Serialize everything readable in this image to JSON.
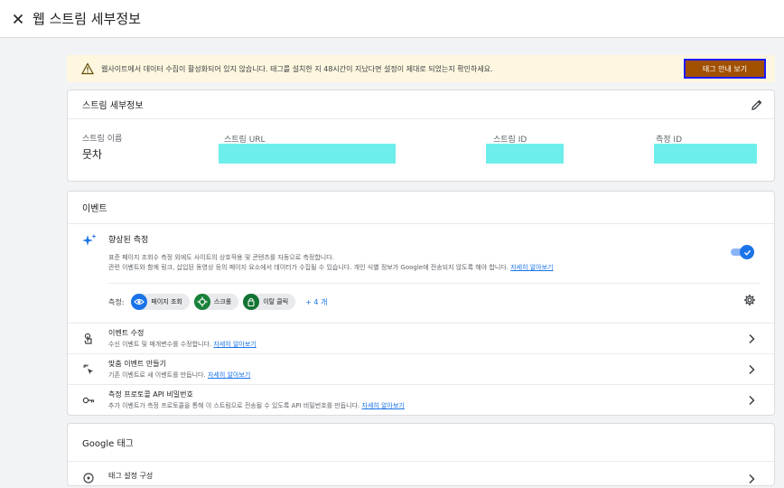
{
  "header": {
    "title": "웹 스트림 세부정보",
    "close_icon": "close-icon"
  },
  "warning": {
    "icon": "warning-icon",
    "text": "웹사이트에서 데이터 수집이 활성화되어 있지 않습니다. 태그를 설치한 지 48시간이 지났다면 설정이 제대로 되었는지 확인하세요.",
    "button_label": "태그 안내 보기",
    "button_color": "#a14f00"
  },
  "stream_details": {
    "title": "스트림 세부정보",
    "edit_icon": "pencil-icon",
    "fields": {
      "name_label": "스트림 이름",
      "name_value": "뭇차",
      "url_label": "스트림 URL",
      "id_label": "스트림 ID",
      "measurement_label": "측정 ID"
    },
    "redaction_color": "#6eeeea"
  },
  "events": {
    "title": "이벤트",
    "enhanced": {
      "icon": "sparkle-icon",
      "title": "향상된 측정",
      "desc_line1": "표준 페이지 조회수 측정 외에도 사이트의 상호작용 및 콘텐츠를 자동으로 측정합니다.",
      "desc_line2": "관련 이벤트와 함께 링크, 삽입된 동영상 등의 페이지 요소에서 데이터가 수집될 수 있습니다. 개인 식별 정보가 Google에 전송되지 않도록 해야 합니다.",
      "learn_more": "자세히 알아보기",
      "toggle_on": true,
      "measure_label": "측정:",
      "chips": [
        {
          "label": "페이지 조회",
          "icon": "eye-icon",
          "color": "#1a73e8"
        },
        {
          "label": "스크롤",
          "icon": "crosshair-icon",
          "color": "#188038"
        },
        {
          "label": "이탈 클릭",
          "icon": "lock-icon",
          "color": "#137333"
        }
      ],
      "more": "+ 4 개",
      "settings_icon": "gear-icon"
    },
    "rows": [
      {
        "icon": "touch-icon",
        "title": "이벤트 수정",
        "desc": "수신 이벤트 및 매개변수를 수정합니다.",
        "link": "자세히 알아보기"
      },
      {
        "icon": "sparkle-click-icon",
        "title": "맞춤 이벤트 만들기",
        "desc": "기존 이벤트로 새 이벤트를 만듭니다.",
        "link": "자세히 알아보기"
      },
      {
        "icon": "key-icon",
        "title": "측정 프로토콜 API 비밀번호",
        "desc": "추가 이벤트가 측정 프로토콜을 통해 이 스트림으로 전송될 수 있도록 API 비밀번호를 만듭니다.",
        "link": "자세히 알아보기"
      }
    ]
  },
  "google_tag": {
    "title": "Google 태그",
    "row_title": "태그 설정 구성",
    "row_icon": "tag-settings-icon"
  }
}
